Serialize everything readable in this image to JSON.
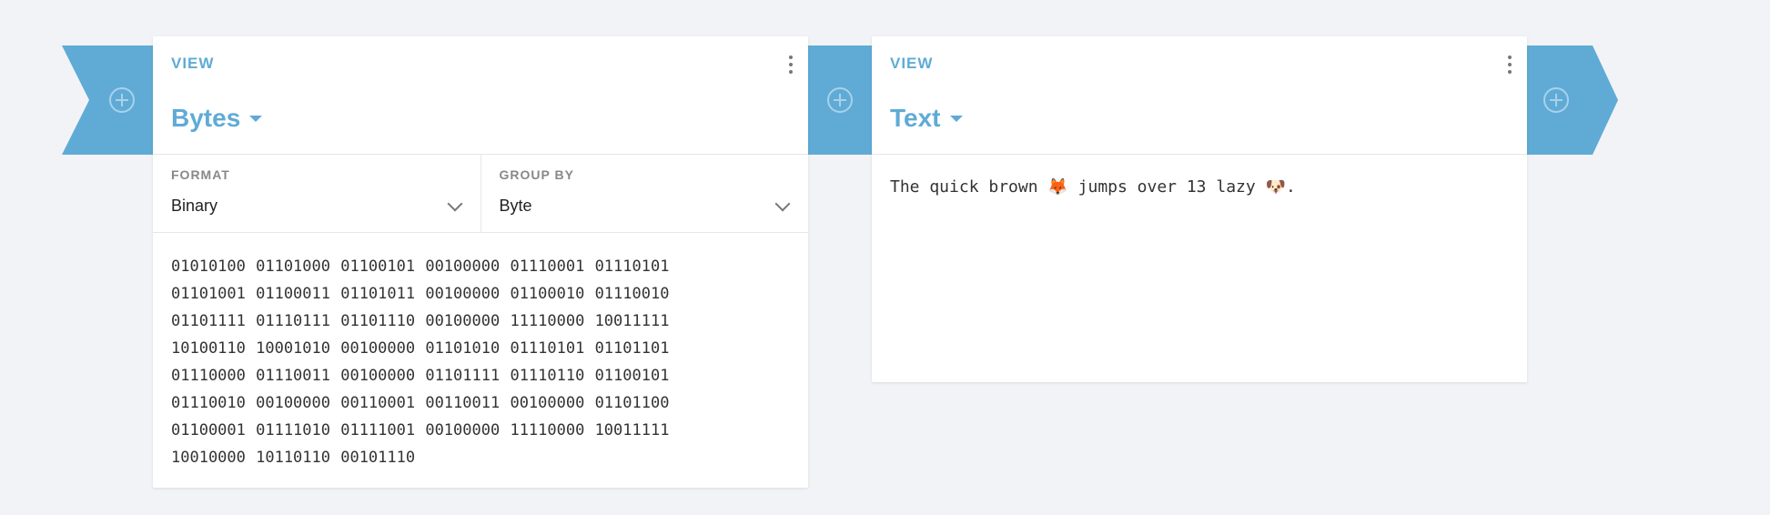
{
  "connectors": {
    "start_add_icon": "plus-circle-icon",
    "mid_add_icon": "plus-circle-icon",
    "end_add_icon": "plus-circle-icon"
  },
  "bytes_card": {
    "view_label": "VIEW",
    "title": "Bytes",
    "format": {
      "label": "FORMAT",
      "value": "Binary"
    },
    "group_by": {
      "label": "GROUP BY",
      "value": "Byte"
    },
    "binary_lines": [
      "01010100 01101000 01100101 00100000 01110001 01110101",
      "01101001 01100011 01101011 00100000 01100010 01110010",
      "01101111 01110111 01101110 00100000 11110000 10011111",
      "10100110 10001010 00100000 01101010 01110101 01101101",
      "01110000 01110011 00100000 01101111 01110110 01100101",
      "01110010 00100000 00110001 00110011 00100000 01101100",
      "01100001 01111010 01111001 00100000 11110000 10011111",
      "10010000 10110110 00101110"
    ]
  },
  "text_card": {
    "view_label": "VIEW",
    "title": "Text",
    "content": "The quick brown 🦊 jumps over 13 lazy 🐶."
  },
  "colors": {
    "accent": "#5fabd6",
    "background": "#f2f3f7"
  }
}
